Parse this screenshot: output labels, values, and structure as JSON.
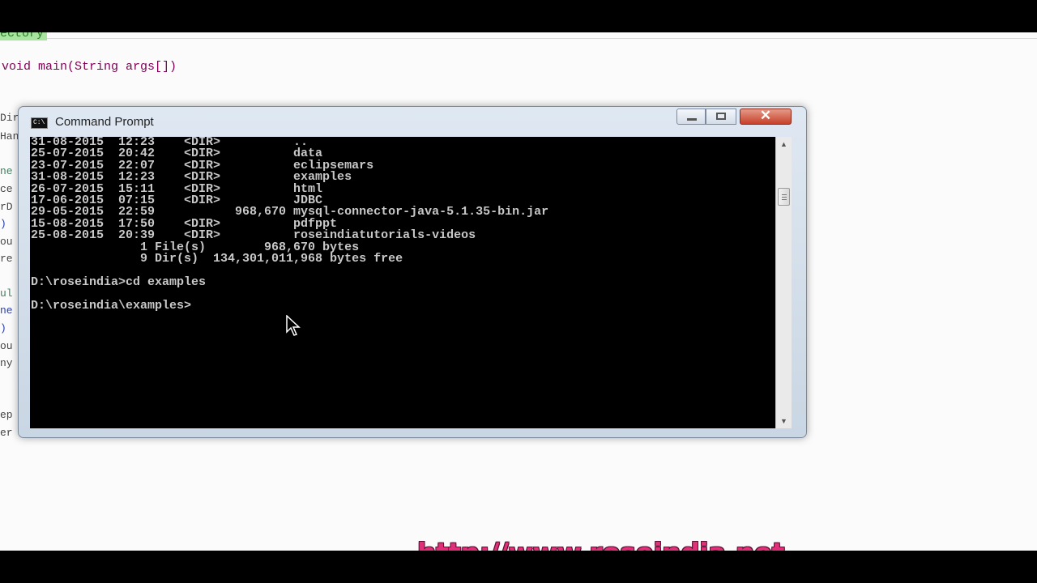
{
  "editor": {
    "highlight_line": "ectory",
    "main_signature": "void main(String args[])",
    "fragments": [
      "Dir",
      "Han",
      "ne",
      "ce",
      "rD",
      ")",
      "ou",
      "re",
      "ul",
      "ne",
      ")",
      "ou",
      "ny",
      "ep",
      "er"
    ]
  },
  "cmd": {
    "window_title": "Command Prompt",
    "icon_text": "C:\\",
    "close_symbol": "✕",
    "console_lines": [
      "31-08-2015  12:23    <DIR>          ..",
      "25-07-2015  20:42    <DIR>          data",
      "23-07-2015  22:07    <DIR>          eclipsemars",
      "31-08-2015  12:23    <DIR>          examples",
      "26-07-2015  15:11    <DIR>          html",
      "17-06-2015  07:15    <DIR>          JDBC",
      "29-05-2015  22:59           968,670 mysql-connector-java-5.1.35-bin.jar",
      "15-08-2015  17:50    <DIR>          pdfppt",
      "25-08-2015  20:39    <DIR>          roseindiatutorials-videos",
      "               1 File(s)        968,670 bytes",
      "               9 Dir(s)  134,301,011,968 bytes free",
      "",
      "D:\\roseindia>cd examples",
      "",
      "D:\\roseindia\\examples>"
    ]
  },
  "watermark": {
    "url": "http://www.roseindia.net"
  },
  "colors": {
    "watermark": "#e0307a",
    "console_bg": "#000000",
    "console_text": "#c8c8c8",
    "close_button": "#c7412a"
  }
}
